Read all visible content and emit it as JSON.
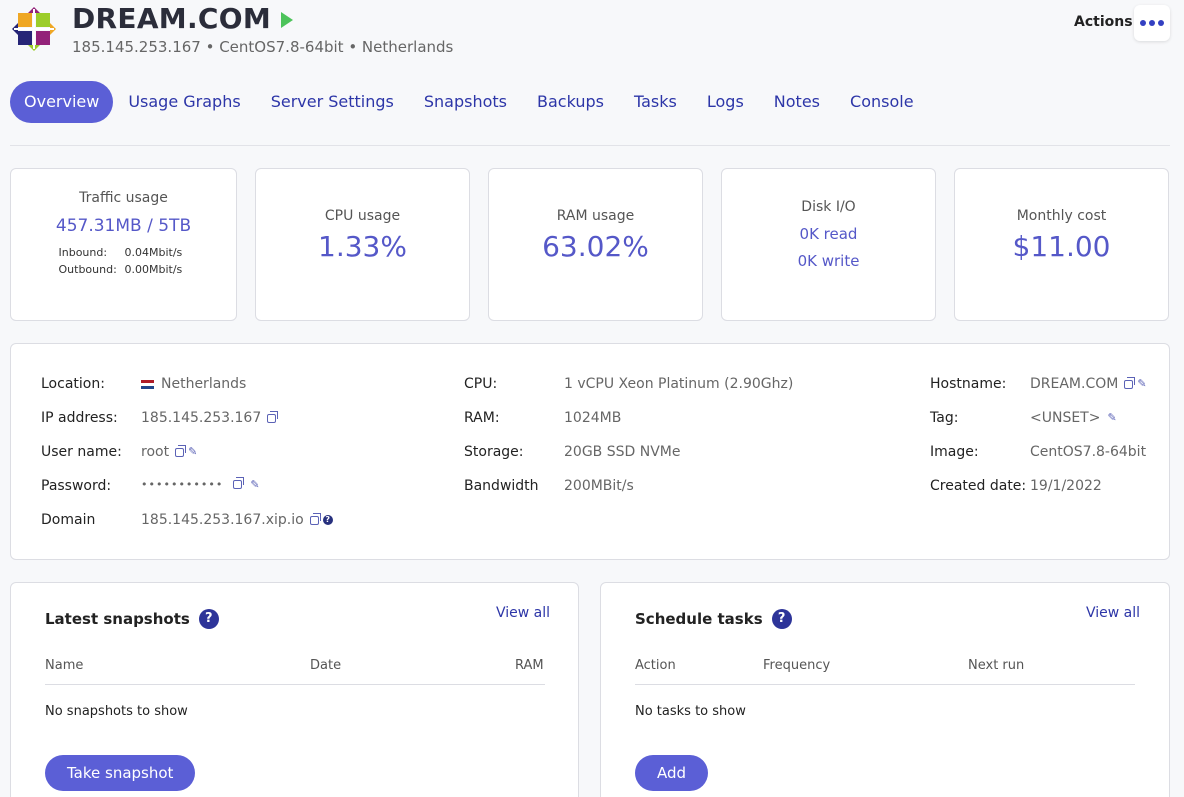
{
  "header": {
    "title": "DREAM.COM",
    "subtitle": "185.145.253.167 • CentOS7.8-64bit • Netherlands",
    "actions_label": "Actions",
    "logo_icon": "centos-logo",
    "status_icon": "play-icon",
    "status_color": "#4cc35a"
  },
  "tabs": [
    {
      "label": "Overview",
      "active": true
    },
    {
      "label": "Usage Graphs"
    },
    {
      "label": "Server Settings"
    },
    {
      "label": "Snapshots"
    },
    {
      "label": "Backups"
    },
    {
      "label": "Tasks"
    },
    {
      "label": "Logs"
    },
    {
      "label": "Notes"
    },
    {
      "label": "Console"
    }
  ],
  "stats": {
    "traffic": {
      "label": "Traffic usage",
      "value": "457.31MB / 5TB",
      "inbound_label": "Inbound:",
      "inbound_value": "0.04Mbit/s",
      "outbound_label": "Outbound:",
      "outbound_value": "0.00Mbit/s"
    },
    "cpu": {
      "label": "CPU usage",
      "value": "1.33%"
    },
    "ram": {
      "label": "RAM usage",
      "value": "63.02%"
    },
    "disk": {
      "label": "Disk I/O",
      "read": "0K read",
      "write": "0K write"
    },
    "cost": {
      "label": "Monthly cost",
      "value": "$11.00"
    }
  },
  "info": {
    "location_label": "Location:",
    "location_value": "Netherlands",
    "ip_label": "IP address:",
    "ip_value": "185.145.253.167",
    "user_label": "User name:",
    "user_value": "root",
    "password_label": "Password:",
    "password_value": "•••••••••••",
    "domain_label": "Domain",
    "domain_value": "185.145.253.167.xip.io",
    "cpu_label": "CPU:",
    "cpu_value": "1 vCPU Xeon Platinum (2.90Ghz)",
    "ram_label": "RAM:",
    "ram_value": "1024MB",
    "storage_label": "Storage:",
    "storage_value": "20GB SSD NVMe",
    "bandwidth_label": "Bandwidth",
    "bandwidth_value": "200MBit/s",
    "hostname_label": "Hostname:",
    "hostname_value": "DREAM.COM",
    "tag_label": "Tag:",
    "tag_value": "<UNSET>",
    "image_label": "Image:",
    "image_value": "CentOS7.8-64bit",
    "created_label": "Created date:",
    "created_value": "19/1/2022"
  },
  "snapshots": {
    "title": "Latest snapshots",
    "view_all": "View all",
    "columns": [
      "Name",
      "Date",
      "RAM"
    ],
    "empty": "No snapshots to show",
    "button": "Take snapshot"
  },
  "tasks": {
    "title": "Schedule tasks",
    "view_all": "View all",
    "columns": [
      "Action",
      "Frequency",
      "Next run"
    ],
    "empty": "No tasks to show",
    "button": "Add"
  },
  "colors": {
    "accent": "#5b5fd6",
    "link": "#2d36a8",
    "stat": "#5558c8"
  }
}
